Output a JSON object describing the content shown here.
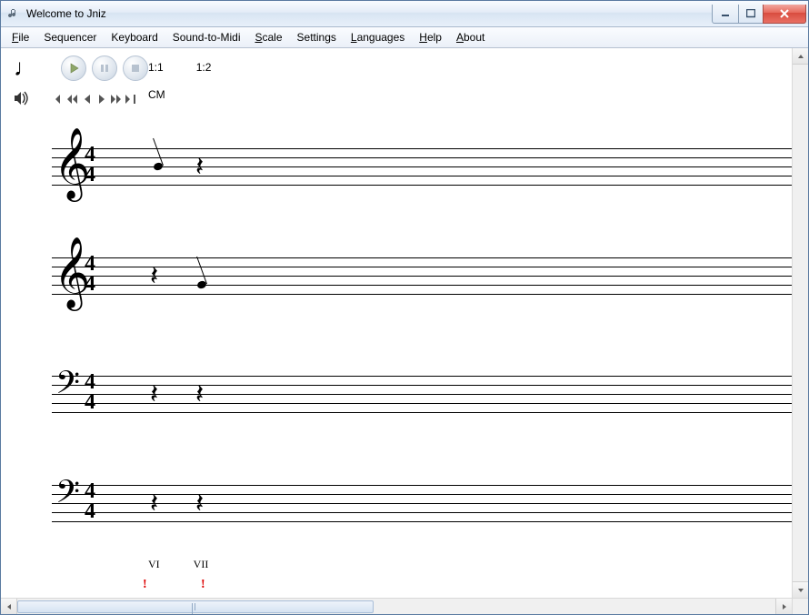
{
  "window": {
    "title": "Welcome to Jniz"
  },
  "menu": {
    "items": [
      {
        "label": "File",
        "accel": "F"
      },
      {
        "label": "Sequencer",
        "accel": ""
      },
      {
        "label": "Keyboard",
        "accel": ""
      },
      {
        "label": "Sound-to-Midi",
        "accel": ""
      },
      {
        "label": "Scale",
        "accel": "S"
      },
      {
        "label": "Settings",
        "accel": ""
      },
      {
        "label": "Languages",
        "accel": "L"
      },
      {
        "label": "Help",
        "accel": "H"
      },
      {
        "label": "About",
        "accel": "A"
      }
    ]
  },
  "transport": {
    "note_value_icon": "quarter-note",
    "play": "play-icon",
    "pause": "pause-icon",
    "stop": "stop-icon",
    "volume": "volume-icon",
    "nav": [
      "rewind-start",
      "rewind",
      "step-back",
      "step-fwd",
      "forward",
      "forward-end"
    ]
  },
  "position": {
    "beat_a": "1:1",
    "beat_b": "1:2",
    "key": "CM"
  },
  "staves": [
    {
      "clef": "treble",
      "time_top": "4",
      "time_bot": "4",
      "events": [
        {
          "type": "note",
          "beat": 1,
          "dir": "up",
          "line": 2
        },
        {
          "type": "rest",
          "beat": 2
        }
      ]
    },
    {
      "clef": "treble",
      "time_top": "4",
      "time_bot": "4",
      "events": [
        {
          "type": "rest",
          "beat": 1
        },
        {
          "type": "note",
          "beat": 2,
          "dir": "up",
          "line": 3
        }
      ]
    },
    {
      "clef": "bass",
      "time_top": "4",
      "time_bot": "4",
      "events": [
        {
          "type": "rest",
          "beat": 1
        },
        {
          "type": "rest",
          "beat": 2
        }
      ]
    },
    {
      "clef": "bass",
      "time_top": "4",
      "time_bot": "4",
      "events": [
        {
          "type": "rest",
          "beat": 1
        },
        {
          "type": "rest",
          "beat": 2
        }
      ]
    }
  ],
  "analysis": {
    "roman": [
      "VI",
      "VII"
    ],
    "errors": [
      "!",
      "!"
    ]
  }
}
